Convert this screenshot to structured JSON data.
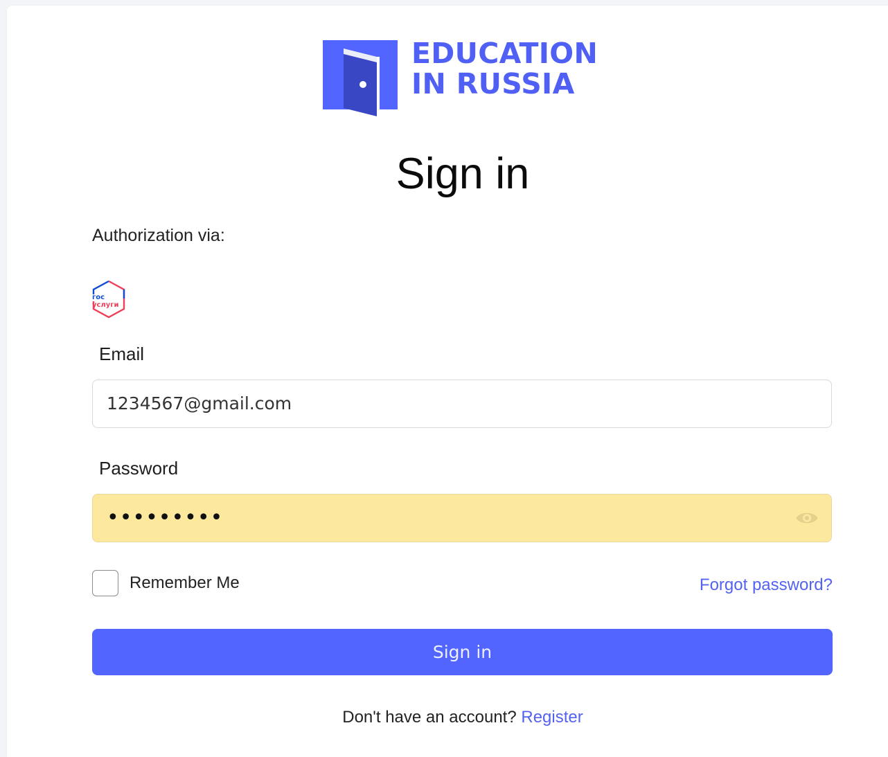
{
  "brand": {
    "line1": "EDUCATION",
    "line2": "IN RUSSIA",
    "color": "#5060f5"
  },
  "title": "Sign in",
  "authorization": {
    "label": "Authorization via:",
    "providers": [
      {
        "icon": "gosuslugi-icon",
        "text_top": "гос",
        "text_bottom": "услуги"
      }
    ]
  },
  "form": {
    "email": {
      "label": "Email",
      "value": "1234567@gmail.com"
    },
    "password": {
      "label": "Password",
      "masked_value": "•••••••••",
      "toggle_icon": "eye-icon"
    },
    "remember_me": {
      "label": "Remember Me",
      "checked": false
    },
    "forgot_password": "Forgot password?",
    "submit_label": "Sign in"
  },
  "footer": {
    "prompt": "Don't have an account?",
    "register_label": "Register"
  },
  "colors": {
    "accent": "#5266ff",
    "link": "#5462f0",
    "autofill": "#fde99d"
  }
}
